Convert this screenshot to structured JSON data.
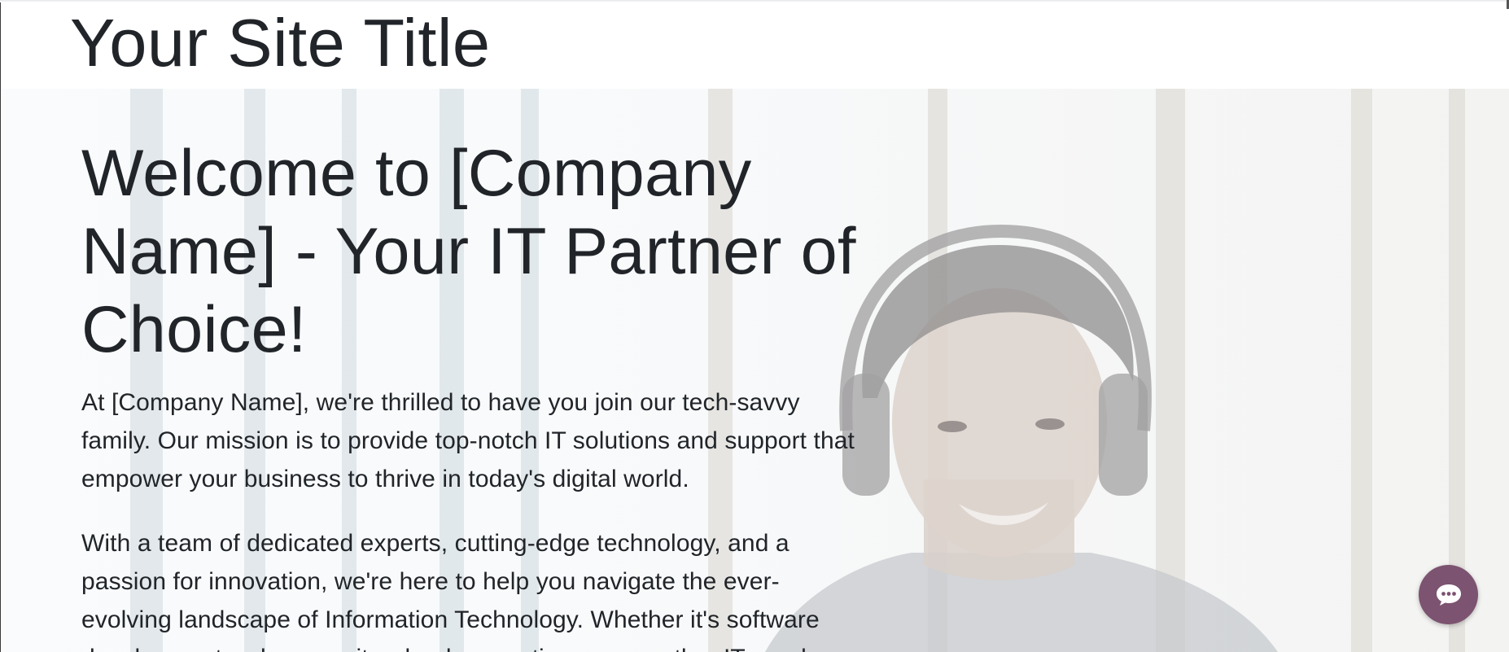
{
  "header": {
    "site_title": "Your Site Title"
  },
  "hero": {
    "heading": "Welcome to [Company Name] - Your IT Partner of Choice!",
    "paragraphs": [
      "At [Company Name], we're thrilled to have you join our tech-savvy family. Our mission is to provide top-notch IT solutions and support that empower your business to thrive in today's digital world.",
      "With a team of dedicated experts, cutting-edge technology, and a passion for innovation, we're here to help you navigate the ever-evolving landscape of Information Technology. Whether it's software development, cybersecurity, cloud computing, or any other IT need,"
    ],
    "background_image": "person-with-headphones-photo"
  },
  "chat": {
    "icon": "chat-bubble-icon",
    "color": "#7c5370"
  }
}
